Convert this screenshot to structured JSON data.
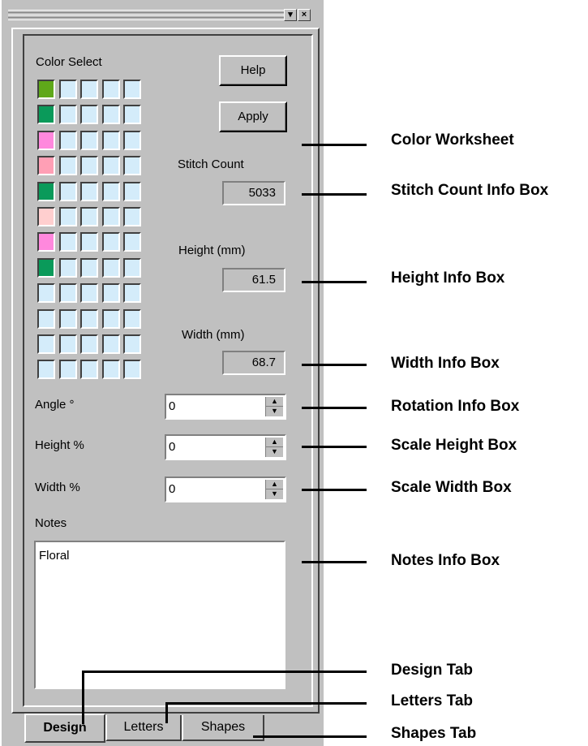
{
  "window": {
    "minimize_glyph": "▾",
    "close_glyph": "×"
  },
  "color_select": {
    "label": "Color Select",
    "rows": [
      [
        "#5fa81a",
        null,
        null,
        null,
        null
      ],
      [
        "#0a9a5a",
        null,
        null,
        null,
        null
      ],
      [
        "#ff88dd",
        null,
        null,
        null,
        null
      ],
      [
        "#ff9fb5",
        null,
        null,
        null,
        null
      ],
      [
        "#0a9a5a",
        null,
        null,
        null,
        null
      ],
      [
        "#ffcfcf",
        null,
        null,
        null,
        null
      ],
      [
        "#ff88dd",
        null,
        null,
        null,
        null
      ],
      [
        "#0a9a5a",
        null,
        null,
        null,
        null
      ],
      [
        null,
        null,
        null,
        null,
        null
      ],
      [
        null,
        null,
        null,
        null,
        null
      ],
      [
        null,
        null,
        null,
        null,
        null
      ],
      [
        null,
        null,
        null,
        null,
        null
      ]
    ]
  },
  "buttons": {
    "help": "Help",
    "apply": "Apply"
  },
  "info": {
    "stitch_count_label": "Stitch Count",
    "stitch_count": "5033",
    "height_label": "Height (mm)",
    "height": "61.5",
    "width_label": "Width (mm)",
    "width": "68.7"
  },
  "fields": {
    "angle_label": "Angle °",
    "angle_value": "0",
    "height_pct_label": "Height %",
    "height_pct_value": "0",
    "width_pct_label": "Width %",
    "width_pct_value": "0"
  },
  "notes": {
    "label": "Notes",
    "value": "Floral"
  },
  "tabs": {
    "design": "Design",
    "letters": "Letters",
    "shapes": "Shapes"
  },
  "callouts": {
    "color_worksheet": "Color Worksheet",
    "stitch_count_box": "Stitch Count Info Box",
    "height_box": "Height Info Box",
    "width_box": "Width Info Box",
    "rotation_box": "Rotation Info Box",
    "scale_height_box": "Scale Height Box",
    "scale_width_box": "Scale Width Box",
    "notes_box": "Notes Info Box",
    "design_tab": "Design Tab",
    "letters_tab": "Letters Tab",
    "shapes_tab": "Shapes Tab"
  }
}
